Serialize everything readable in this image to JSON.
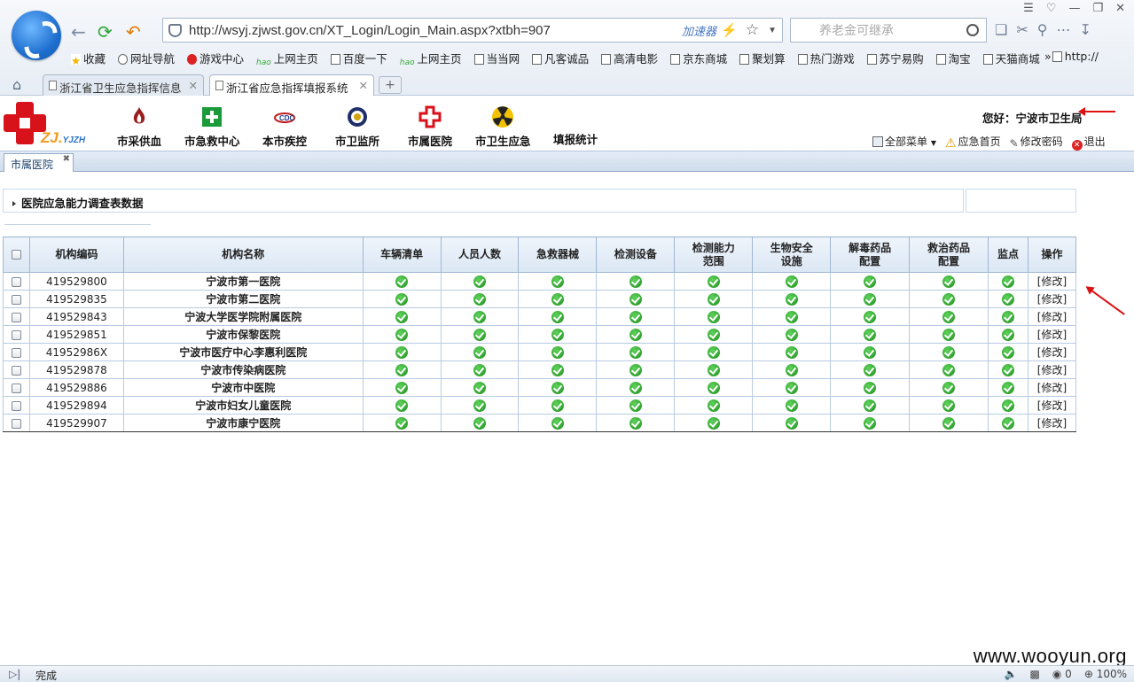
{
  "browser": {
    "url": "http://wsyj.zjwst.gov.cn/XT_Login/Login_Main.aspx?xtbh=907",
    "accelerator_label": "加速器",
    "search_placeholder": "养老金可继承",
    "bookmarks": [
      "收藏",
      "网址导航",
      "游戏中心",
      "上网主页",
      "百度一下",
      "上网主页",
      "当当网",
      "凡客诚品",
      "高清电影",
      "京东商城",
      "聚划算",
      "热门游戏",
      "苏宁易购",
      "淘宝",
      "天猫商城",
      "http://"
    ],
    "tabs": [
      {
        "label": "浙江省卫生应急指挥信息"
      },
      {
        "label": "浙江省应急指挥填报系统"
      }
    ],
    "status_text": "完成",
    "status_right": {
      "count": "0",
      "zoom": "100%"
    }
  },
  "app": {
    "modules": [
      "市采供血",
      "市急救中心",
      "本市疾控",
      "市卫监所",
      "市属医院",
      "市卫生应急",
      "填报统计"
    ],
    "greeting": "您好：宁波市卫生局",
    "quick_links": [
      "全部菜单",
      "应急首页",
      "修改密码",
      "退出"
    ],
    "page_tab": "市属医院",
    "section_title": "医院应急能力调查表数据"
  },
  "table": {
    "headers": [
      "机构编码",
      "机构名称",
      "车辆清单",
      "人员人数",
      "急救器械",
      "检测设备",
      "检测能力范围",
      "生物安全设施",
      "解毒药品配置",
      "救治药品配置",
      "监点",
      "操作"
    ],
    "headers_line1": [
      "机构编码",
      "机构名称",
      "车辆清单",
      "人员人数",
      "急救器械",
      "检测设备",
      "检测能力",
      "生物安全",
      "解毒药品",
      "救治药品",
      "监点",
      "操作"
    ],
    "headers_line2": [
      "",
      "",
      "",
      "",
      "",
      "",
      "范围",
      "设施",
      "配置",
      "配置",
      "",
      ""
    ],
    "action_label": "[修改]",
    "rows": [
      {
        "code": "419529800",
        "name": "宁波市第一医院"
      },
      {
        "code": "419529835",
        "name": "宁波市第二医院"
      },
      {
        "code": "419529843",
        "name": "宁波大学医学院附属医院"
      },
      {
        "code": "419529851",
        "name": "宁波市保黎医院"
      },
      {
        "code": "41952986X",
        "name": "宁波市医疗中心李惠利医院"
      },
      {
        "code": "419529878",
        "name": "宁波市传染病医院"
      },
      {
        "code": "419529886",
        "name": "宁波市中医院"
      },
      {
        "code": "419529894",
        "name": "宁波市妇女儿童医院"
      },
      {
        "code": "419529907",
        "name": "宁波市康宁医院"
      }
    ]
  },
  "watermark": "www.wooyun.org",
  "colors": {
    "accent_red": "#d8121b",
    "header_blue": "#dbe7f4",
    "check_green": "#1e8d1d"
  }
}
